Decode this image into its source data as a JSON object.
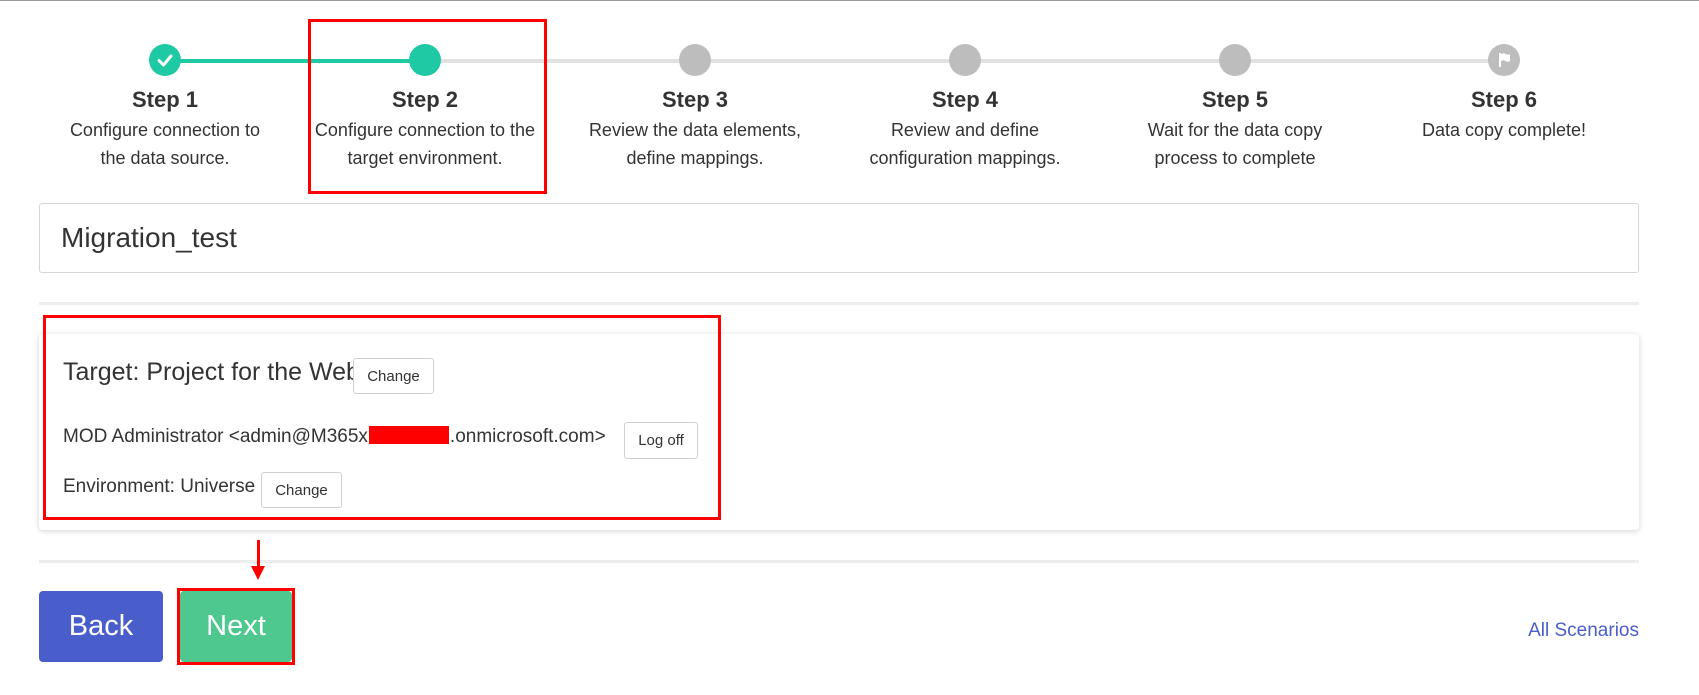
{
  "steps": [
    {
      "title": "Step 1",
      "desc_line1": "Configure connection to",
      "desc_line2": "the data source.",
      "state": "done"
    },
    {
      "title": "Step 2",
      "desc_line1": "Configure connection to the",
      "desc_line2": "target environment.",
      "state": "current"
    },
    {
      "title": "Step 3",
      "desc_line1": "Review the data elements,",
      "desc_line2": "define mappings.",
      "state": "todo"
    },
    {
      "title": "Step 4",
      "desc_line1": "Review and define",
      "desc_line2": "configuration mappings.",
      "state": "todo"
    },
    {
      "title": "Step 5",
      "desc_line1": "Wait for the data copy",
      "desc_line2": "process to complete",
      "state": "todo"
    },
    {
      "title": "Step 6",
      "desc_line1": "Data copy complete!",
      "desc_line2": "",
      "state": "todo"
    }
  ],
  "scenario_name": "Migration_test",
  "target": {
    "label": "Target: Project for the Web",
    "change_label": "Change",
    "user_prefix": "MOD Administrator <admin@M365x",
    "user_suffix": ".onmicrosoft.com>",
    "logoff_label": "Log off",
    "environment_label": "Environment: Universe",
    "env_change_label": "Change"
  },
  "buttons": {
    "back_label": "Back",
    "next_label": "Next"
  },
  "all_scenarios_label": "All Scenarios",
  "colors": {
    "accent_teal": "#1ec9a4",
    "back_blue": "#4a5ecb",
    "next_green": "#4ec88f",
    "highlight_red": "#ff0000",
    "inactive_grey": "#bdbdbd"
  },
  "icons": {
    "step1": "check-icon",
    "step6": "flag-icon"
  }
}
